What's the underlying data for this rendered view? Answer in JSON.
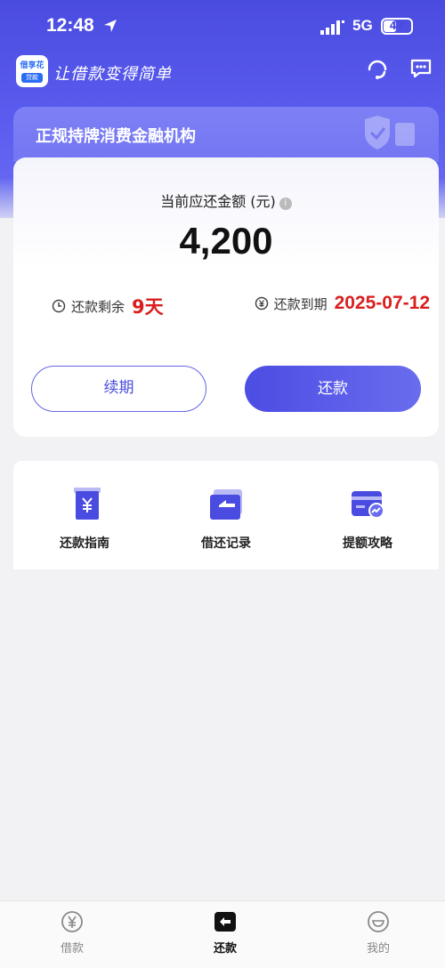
{
  "status_bar": {
    "time": "12:48",
    "network": "5G",
    "battery": "47",
    "battery_level": 0.47
  },
  "header": {
    "logo_name": "借享花",
    "logo_sub": "贷款",
    "slogan": "让借款变得简单",
    "icons": [
      "headset-icon",
      "chat-icon"
    ]
  },
  "banner": {
    "title": "正规持牌消费金融机构"
  },
  "repayment": {
    "due_label": "当前应还金额 (元)",
    "amount": "4,200",
    "remaining_label": "还款剩余",
    "remaining_value": "9天",
    "due_date_label": "还款到期",
    "due_date_value": "2025-07-12",
    "renew_button": "续期",
    "repay_button": "还款"
  },
  "quick_menu": {
    "items": [
      {
        "label": "还款指南",
        "icon": "yuan-guide-icon"
      },
      {
        "label": "借还记录",
        "icon": "record-icon"
      },
      {
        "label": "提额攻略",
        "icon": "card-chart-icon"
      }
    ]
  },
  "tabbar": {
    "items": [
      {
        "label": "借款",
        "icon": "yuan-circle-icon",
        "active": false
      },
      {
        "label": "还款",
        "icon": "return-icon",
        "active": true
      },
      {
        "label": "我的",
        "icon": "face-icon",
        "active": false
      }
    ]
  },
  "colors": {
    "primary": "#4a4be0",
    "accent_red": "#d91f1f",
    "background": "#f2f2f4"
  }
}
